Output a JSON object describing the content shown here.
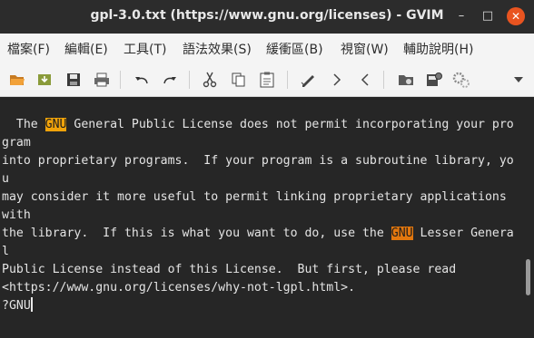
{
  "window": {
    "title": "gpl-3.0.txt (https://www.gnu.org/licenses) - GVIM",
    "controls": {
      "minimize": "–",
      "maximize": "□",
      "close": "✕"
    }
  },
  "menubar": {
    "items": [
      "檔案(F)",
      "編輯(E)",
      "工具(T)",
      "語法效果(S)",
      "緩衝區(B)",
      "視窗(W)",
      "輔助說明(H)"
    ]
  },
  "toolbar": {
    "buttons": [
      "open-icon",
      "load-session-icon",
      "save-icon",
      "print-icon",
      "undo-icon",
      "redo-icon",
      "cut-icon",
      "copy-icon",
      "paste-icon",
      "find-replace-icon",
      "find-next-icon",
      "find-prev-icon",
      "load-script-icon",
      "build-icon",
      "settings-icon",
      "overflow-arrow-icon"
    ]
  },
  "editor": {
    "lines": [
      {
        "pre": "  The ",
        "match": "GNU",
        "post": " General Public License does not permit incorporating your pro"
      },
      {
        "text": "gram"
      },
      {
        "text": "into proprietary programs.  If your program is a subroutine library, yo"
      },
      {
        "text": "u"
      },
      {
        "text": "may consider it more useful to permit linking proprietary applications "
      },
      {
        "text": "with"
      },
      {
        "pre": "the library.  If this is what you want to do, use the ",
        "match": "GNU",
        "post": " Lesser Genera"
      },
      {
        "text": "l"
      },
      {
        "text": "Public License instead of this License.  But first, please read"
      },
      {
        "text": "<https://www.gnu.org/licenses/why-not-lgpl.html>."
      }
    ],
    "command_line": "?GNU"
  },
  "colors": {
    "search_highlight": "#f0a30a",
    "current_match": "#e2770e",
    "close_button": "#e95420",
    "editor_background": "#262626"
  }
}
